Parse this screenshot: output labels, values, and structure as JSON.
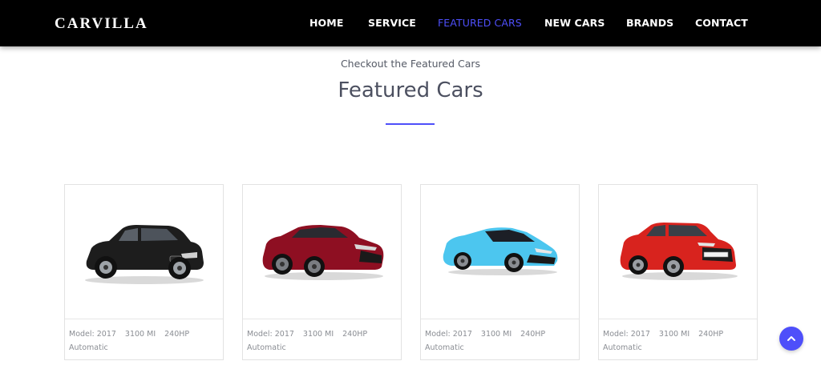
{
  "brand": "CARVILLA",
  "nav": {
    "items": [
      {
        "label": "HOME",
        "active": false
      },
      {
        "label": "SERVICE",
        "active": false
      },
      {
        "label": "FEATURED CARS",
        "active": true
      },
      {
        "label": "NEW CARS",
        "active": false
      },
      {
        "label": "BRANDS",
        "active": false
      },
      {
        "label": "CONTACT",
        "active": false
      }
    ]
  },
  "section": {
    "subtitle": "Checkout the Featured Cars",
    "title": "Featured Cars"
  },
  "cards": [
    {
      "car_color": "#1d1d1d",
      "car": "black-suv",
      "model": "Model: 2017",
      "mileage": "3100 MI",
      "power": "240HP",
      "transmission": "Automatic"
    },
    {
      "car_color": "#8e0f22",
      "car": "red-sports-coupe",
      "model": "Model: 2017",
      "mileage": "3100 MI",
      "power": "240HP",
      "transmission": "Automatic"
    },
    {
      "car_color": "#4cc6ef",
      "car": "blue-supercar",
      "model": "Model: 2017",
      "mileage": "3100 MI",
      "power": "240HP",
      "transmission": "Automatic"
    },
    {
      "car_color": "#d8231e",
      "car": "red-wagon",
      "model": "Model: 2017",
      "mileage": "3100 MI",
      "power": "240HP",
      "transmission": "Automatic"
    }
  ],
  "colors": {
    "accent": "#4e4ffa",
    "nav_background": "#000000",
    "title_text": "#4c5060",
    "spec_text": "#8a8d93"
  },
  "scroll_top_icon": "chevron-up-icon"
}
